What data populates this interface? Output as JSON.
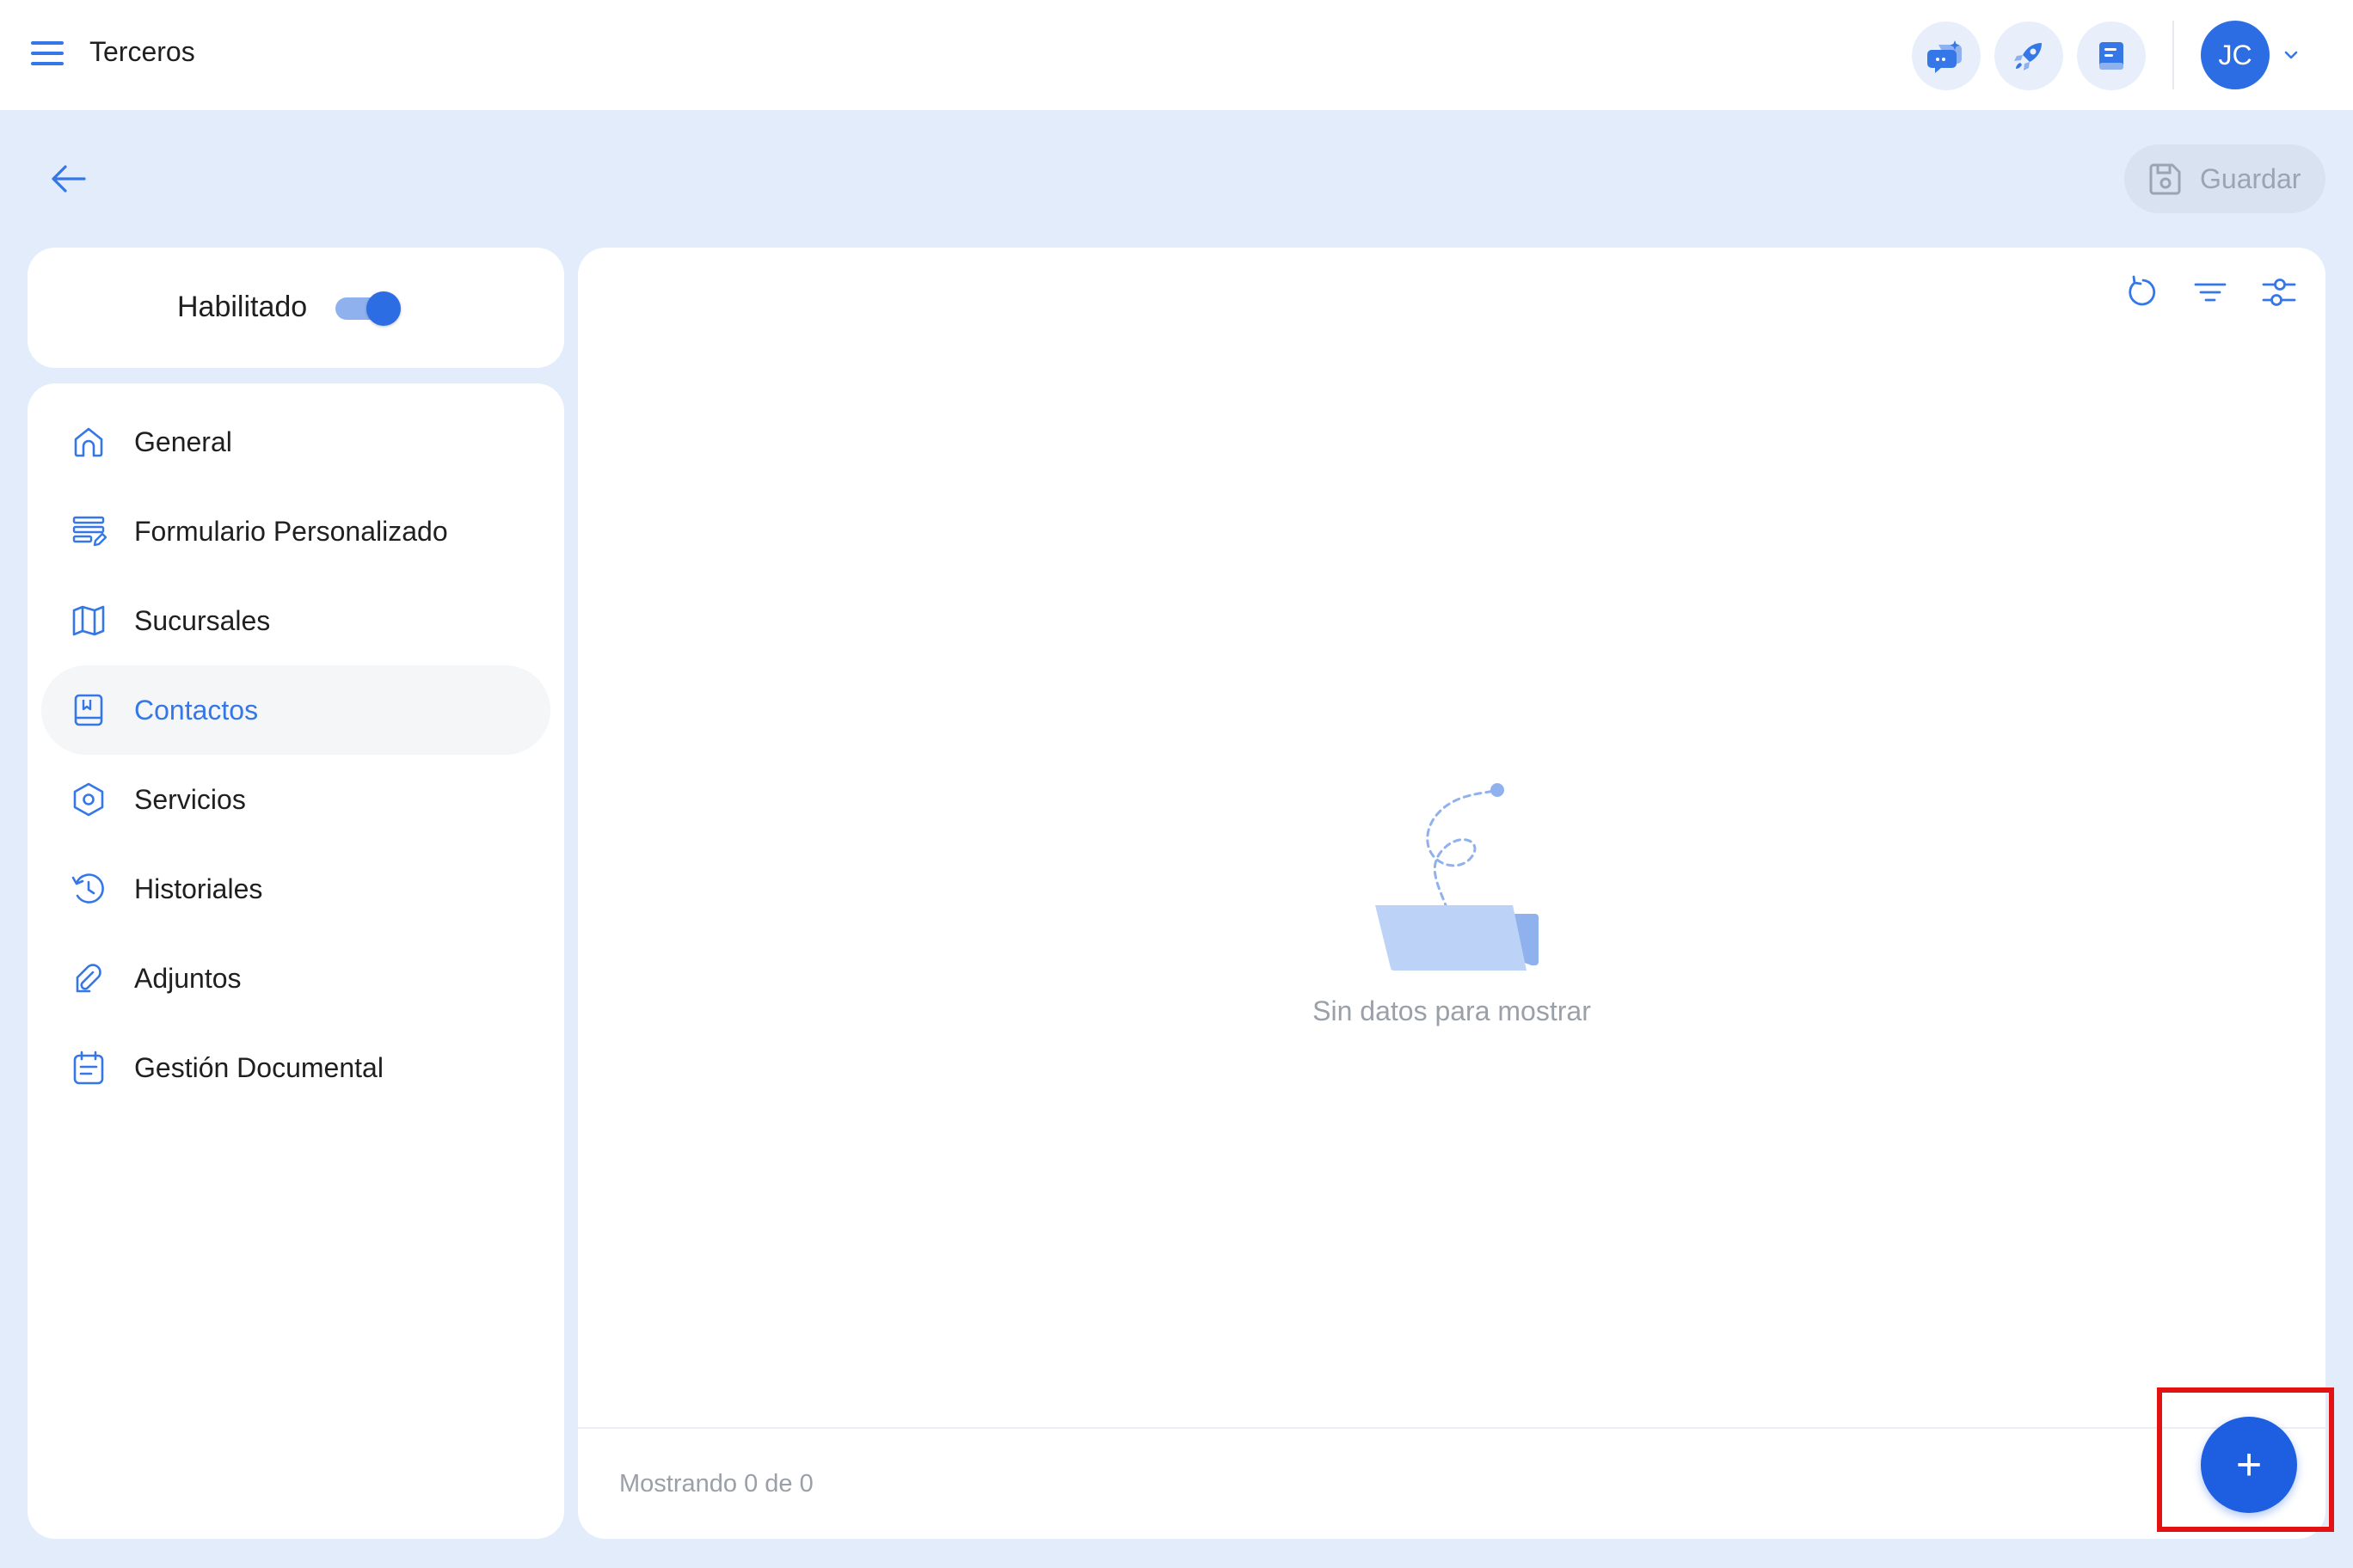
{
  "header": {
    "title": "Terceros",
    "menu_icon": "hamburger-menu-icon",
    "actions": [
      {
        "name": "chat-help-icon"
      },
      {
        "name": "rocket-icon"
      },
      {
        "name": "book-icon"
      }
    ],
    "user": {
      "initials": "JC"
    }
  },
  "toolbar": {
    "back_icon": "arrow-left-icon",
    "save_label": "Guardar",
    "save_icon": "floppy-disk-icon"
  },
  "status_card": {
    "label": "Habilitado",
    "enabled": true
  },
  "sidebar": {
    "items": [
      {
        "label": "General",
        "icon": "home-icon",
        "active": false
      },
      {
        "label": "Formulario Personalizado",
        "icon": "form-edit-icon",
        "active": false
      },
      {
        "label": "Sucursales",
        "icon": "map-icon",
        "active": false
      },
      {
        "label": "Contactos",
        "icon": "contact-book-icon",
        "active": true
      },
      {
        "label": "Servicios",
        "icon": "hexagon-icon",
        "active": false
      },
      {
        "label": "Historiales",
        "icon": "history-icon",
        "active": false
      },
      {
        "label": "Adjuntos",
        "icon": "paperclip-icon",
        "active": false
      },
      {
        "label": "Gestión Documental",
        "icon": "calendar-doc-icon",
        "active": false
      }
    ]
  },
  "main": {
    "tools": [
      {
        "name": "refresh-icon"
      },
      {
        "name": "filter-icon"
      },
      {
        "name": "settings-sliders-icon"
      }
    ],
    "empty_message": "Sin datos para mostrar",
    "footer_count": "Mostrando 0 de 0",
    "add_label": "+"
  },
  "colors": {
    "accent": "#3577e6",
    "fab": "#1d5fe0",
    "background": "#e3ecfb",
    "highlight": "#e31212"
  }
}
